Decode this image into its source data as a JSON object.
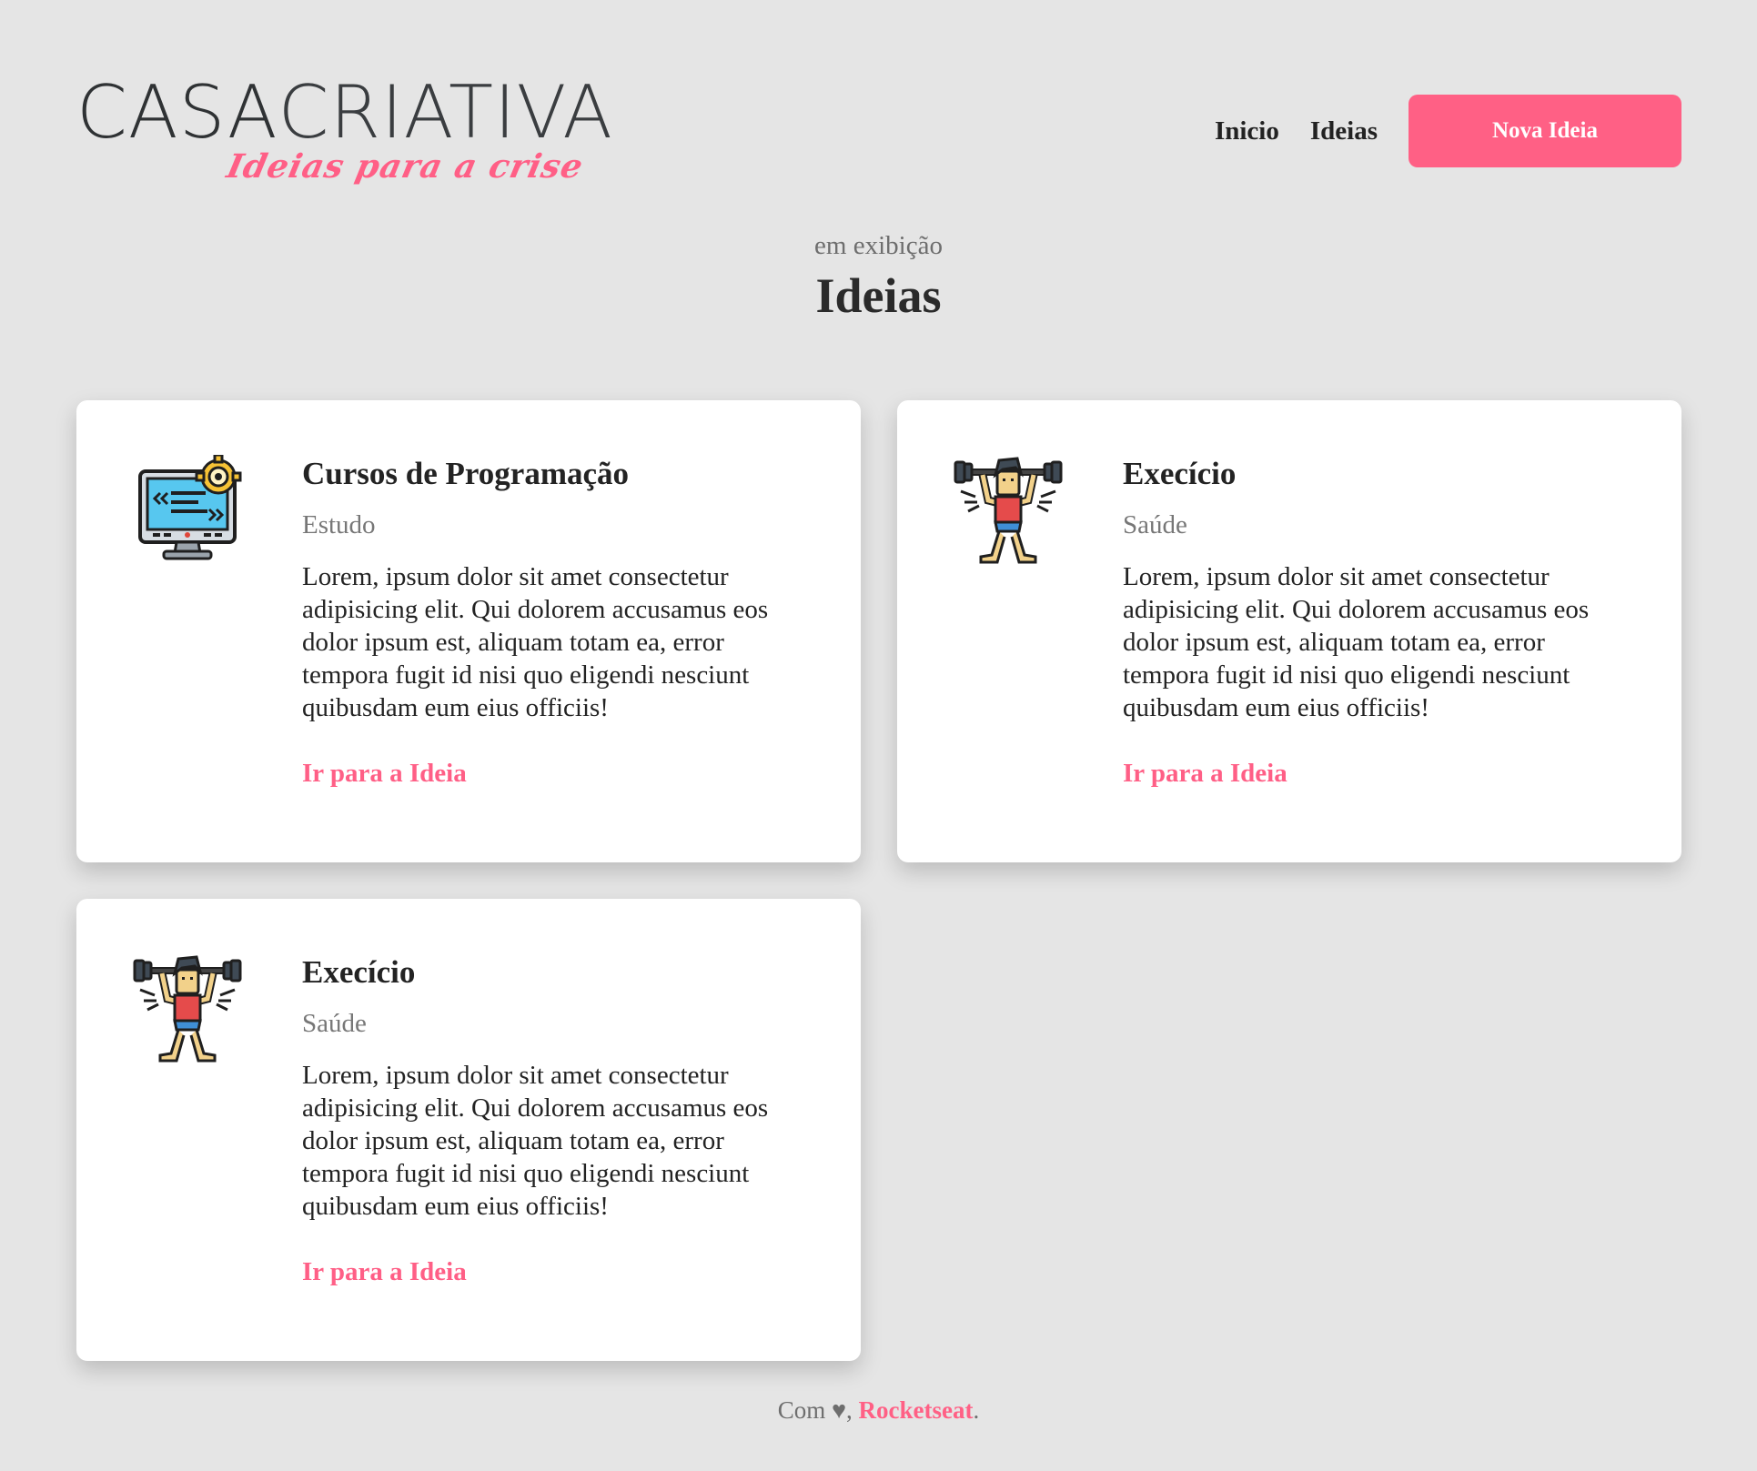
{
  "header": {
    "logo_main_bold": "CASA",
    "logo_main_light": "CRIATIVA",
    "logo_tagline": "Ideias para a crise",
    "nav": [
      {
        "label": "Inicio"
      },
      {
        "label": "Ideias"
      }
    ],
    "cta_label": "Nova Ideia",
    "accent_color": "#ff6085"
  },
  "section": {
    "subtitle": "em exibição",
    "title": "Ideias"
  },
  "cards": [
    {
      "icon": "computer-code-gear-icon",
      "title": "Cursos de Programação",
      "category": "Estudo",
      "description": "Lorem, ipsum dolor sit amet consectetur adipisicing elit. Qui dolorem accusamus eos dolor ipsum est, aliquam totam ea, error tempora fugit id nisi quo eligendi nesciunt quibusdam eum eius officiis!",
      "link_label": "Ir para a Ideia"
    },
    {
      "icon": "weightlifter-icon",
      "title": "Execício",
      "category": "Saúde",
      "description": "Lorem, ipsum dolor sit amet consectetur adipisicing elit. Qui dolorem accusamus eos dolor ipsum est, aliquam totam ea, error tempora fugit id nisi quo eligendi nesciunt quibusdam eum eius officiis!",
      "link_label": "Ir para a Ideia"
    },
    {
      "icon": "weightlifter-icon",
      "title": "Execício",
      "category": "Saúde",
      "description": "Lorem, ipsum dolor sit amet consectetur adipisicing elit. Qui dolorem accusamus eos dolor ipsum est, aliquam totam ea, error tempora fugit id nisi quo eligendi nesciunt quibusdam eum eius officiis!",
      "link_label": "Ir para a Ideia"
    }
  ],
  "footer": {
    "prefix": "Com",
    "heart": "♥",
    "comma": ",",
    "link_label": "Rocketseat",
    "suffix": "."
  }
}
